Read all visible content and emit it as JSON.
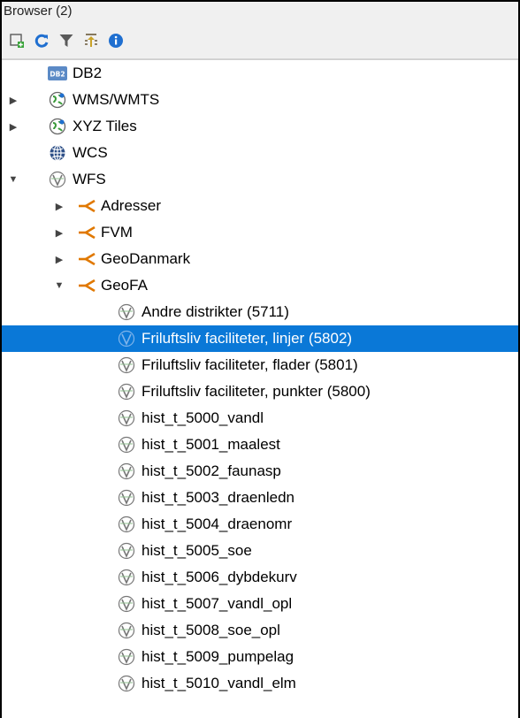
{
  "panel": {
    "title": "Browser (2)",
    "corner_glyph": "("
  },
  "toolbar": {
    "buttons": [
      {
        "name": "add-selected-layers-button",
        "icon": "add-layer-icon"
      },
      {
        "name": "refresh-button",
        "icon": "refresh-icon"
      },
      {
        "name": "filter-browser-button",
        "icon": "filter-icon"
      },
      {
        "name": "collapse-all-button",
        "icon": "collapse-icon"
      },
      {
        "name": "properties-button",
        "icon": "info-icon"
      }
    ]
  },
  "tree": {
    "db2": {
      "label": "DB2"
    },
    "wms": {
      "label": "WMS/WMTS"
    },
    "xyz": {
      "label": "XYZ Tiles"
    },
    "wcs": {
      "label": "WCS"
    },
    "wfs": {
      "label": "WFS",
      "connections": [
        {
          "label": "Adresser",
          "expanded": false
        },
        {
          "label": "FVM",
          "expanded": false
        },
        {
          "label": "GeoDanmark",
          "expanded": false
        },
        {
          "label": "GeoFA",
          "expanded": true
        }
      ]
    },
    "geofa_layers": [
      {
        "label": "Andre distrikter (5711)",
        "selected": false
      },
      {
        "label": "Friluftsliv faciliteter,  linjer (5802)",
        "selected": true
      },
      {
        "label": "Friluftsliv faciliteter, flader (5801)",
        "selected": false
      },
      {
        "label": "Friluftsliv faciliteter, punkter (5800)",
        "selected": false
      },
      {
        "label": "hist_t_5000_vandl",
        "selected": false
      },
      {
        "label": "hist_t_5001_maalest",
        "selected": false
      },
      {
        "label": "hist_t_5002_faunasp",
        "selected": false
      },
      {
        "label": "hist_t_5003_draenledn",
        "selected": false
      },
      {
        "label": "hist_t_5004_draenomr",
        "selected": false
      },
      {
        "label": "hist_t_5005_soe",
        "selected": false
      },
      {
        "label": "hist_t_5006_dybdekurv",
        "selected": false
      },
      {
        "label": "hist_t_5007_vandl_opl",
        "selected": false
      },
      {
        "label": "hist_t_5008_soe_opl",
        "selected": false
      },
      {
        "label": "hist_t_5009_pumpelag",
        "selected": false
      },
      {
        "label": "hist_t_5010_vandl_elm",
        "selected": false
      }
    ]
  },
  "colors": {
    "selection": "#0a78d7",
    "connection_orange": "#e07800",
    "refresh_blue": "#1f6fd0"
  }
}
